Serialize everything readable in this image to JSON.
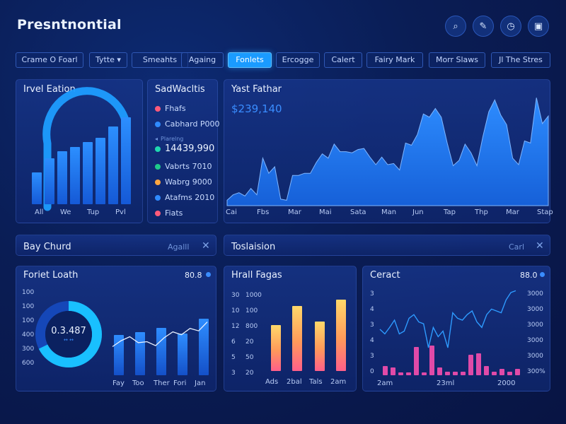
{
  "app": {
    "title": "Presntnontial"
  },
  "toolbar_icons": [
    {
      "name": "search-icon",
      "glyph": "⌕"
    },
    {
      "name": "pen-icon",
      "glyph": "✎"
    },
    {
      "name": "timer-icon",
      "glyph": "◷"
    },
    {
      "name": "briefcase-icon",
      "glyph": "▣"
    }
  ],
  "tabs": [
    {
      "label": "Crame O Foarl"
    },
    {
      "label": "Tytte ▾"
    },
    {
      "label": "Smeahts"
    },
    {
      "label": "Againg"
    },
    {
      "label": "Fonlets",
      "active": true
    },
    {
      "label": "Ercogge"
    },
    {
      "label": "Calert"
    },
    {
      "label": "Fairy Mark"
    },
    {
      "label": "Morr Slaws"
    },
    {
      "label": "Jl The Stres"
    }
  ],
  "panel_left": {
    "title": "Irvel Eation",
    "chart_data": {
      "type": "bar",
      "categories": [
        "All",
        "We",
        "Tup",
        "Pvl"
      ],
      "values": [
        35,
        50,
        58,
        62,
        68,
        72,
        85,
        95
      ],
      "ylim": [
        0,
        100
      ],
      "color": "#1f7ff0"
    },
    "xlabels": [
      "All",
      "We",
      "Tup",
      "Pvl"
    ]
  },
  "panel_legend": {
    "title": "SadWacltis",
    "rows": [
      {
        "label": "Fhafs",
        "color": "#ff5a7a"
      },
      {
        "label": "Cabhard P000",
        "color": "#2f8bff"
      },
      {
        "label": "Plarelng",
        "color": "#2f8bff",
        "small": true
      },
      {
        "label": "14439,990",
        "color": "#1fd8b0",
        "big": true
      },
      {
        "label": "Vabrts 7010",
        "color": "#1fc98a"
      },
      {
        "label": "Wabrg 9000",
        "color": "#ffa640"
      },
      {
        "label": "Atafms 2010",
        "color": "#2f8bff"
      },
      {
        "label": "Fiats",
        "color": "#ff5a7a"
      }
    ]
  },
  "panel_area": {
    "title": "Yast Fathar",
    "value": "$239,140",
    "chart_data": {
      "type": "area",
      "x": [
        "Cai",
        "Fbs",
        "Mar",
        "Mai",
        "Sata",
        "Man",
        "Jun",
        "Tap",
        "Thp",
        "Mar",
        "Stap"
      ],
      "values": [
        5,
        10,
        12,
        9,
        16,
        10,
        44,
        30,
        36,
        6,
        5,
        28,
        28,
        30,
        30,
        40,
        48,
        44,
        57,
        50,
        50,
        49,
        52,
        53,
        45,
        38,
        45,
        38,
        39,
        33,
        58,
        56,
        66,
        85,
        82,
        90,
        82,
        58,
        37,
        42,
        57,
        49,
        37,
        64,
        87,
        98,
        84,
        75,
        44,
        38,
        60,
        58,
        100,
        76,
        83
      ],
      "ylim": [
        0,
        110
      ]
    }
  },
  "strip_left": {
    "title": "Bay Churd",
    "action": "Agalll",
    "close": "✕"
  },
  "strip_right": {
    "title": "Toslaision",
    "action": "Carl",
    "close": "✕"
  },
  "panel_bl": {
    "title": "Foriet Loath",
    "value": "80.8",
    "donut_value": "0.3.487",
    "donut_caption": "↔ ↔",
    "y_ticks": [
      "100",
      "100",
      "100",
      "400",
      "300",
      "600"
    ],
    "xlabels": [
      "Fay",
      "Too",
      "Ther",
      "Fori",
      "Jan"
    ],
    "chart_data": {
      "type": "bar",
      "values": [
        67,
        72,
        80,
        70,
        78,
        74,
        95
      ],
      "line": [
        58,
        70,
        78,
        66,
        68,
        60,
        76,
        88,
        82,
        95,
        90,
        108
      ],
      "ylim": [
        0,
        110
      ]
    }
  },
  "panel_bm": {
    "title": "Hrall Fagas",
    "y_ticks_left": [
      "30",
      "10",
      "12",
      "6",
      "5",
      "3"
    ],
    "y_ticks_right": [
      "1000",
      "100",
      "800",
      "20",
      "50",
      "20"
    ],
    "xlabels": [
      "Ads",
      "2bal",
      "Tals",
      "2am"
    ],
    "chart_data": {
      "type": "bar",
      "categories": [
        "Ads",
        "2bal",
        "Tals",
        "2am"
      ],
      "values": [
        54,
        77,
        58,
        84
      ],
      "ylim": [
        0,
        100
      ]
    }
  },
  "panel_br": {
    "title": "Ceract",
    "value": "88.0",
    "y_ticks_left": [
      "3",
      "4",
      "3",
      "4",
      "3",
      "0"
    ],
    "y_ticks_right": [
      "3000",
      "3000",
      "3000",
      "3000",
      "3000",
      "300%"
    ],
    "xlabels": [
      "2am",
      "23ml",
      "2000"
    ],
    "chart_data": {
      "type": "line",
      "line": [
        50,
        45,
        52,
        60,
        45,
        48,
        62,
        66,
        58,
        56,
        30,
        52,
        42,
        48,
        30,
        68,
        62,
        60,
        66,
        70,
        58,
        52,
        66,
        72,
        70,
        68,
        82,
        90,
        92
      ],
      "bars": [
        12,
        10,
        4,
        4,
        36,
        4,
        38,
        10,
        5,
        5,
        5,
        26,
        28,
        12,
        5,
        8,
        5,
        8
      ],
      "ylim": [
        0,
        100
      ]
    }
  }
}
